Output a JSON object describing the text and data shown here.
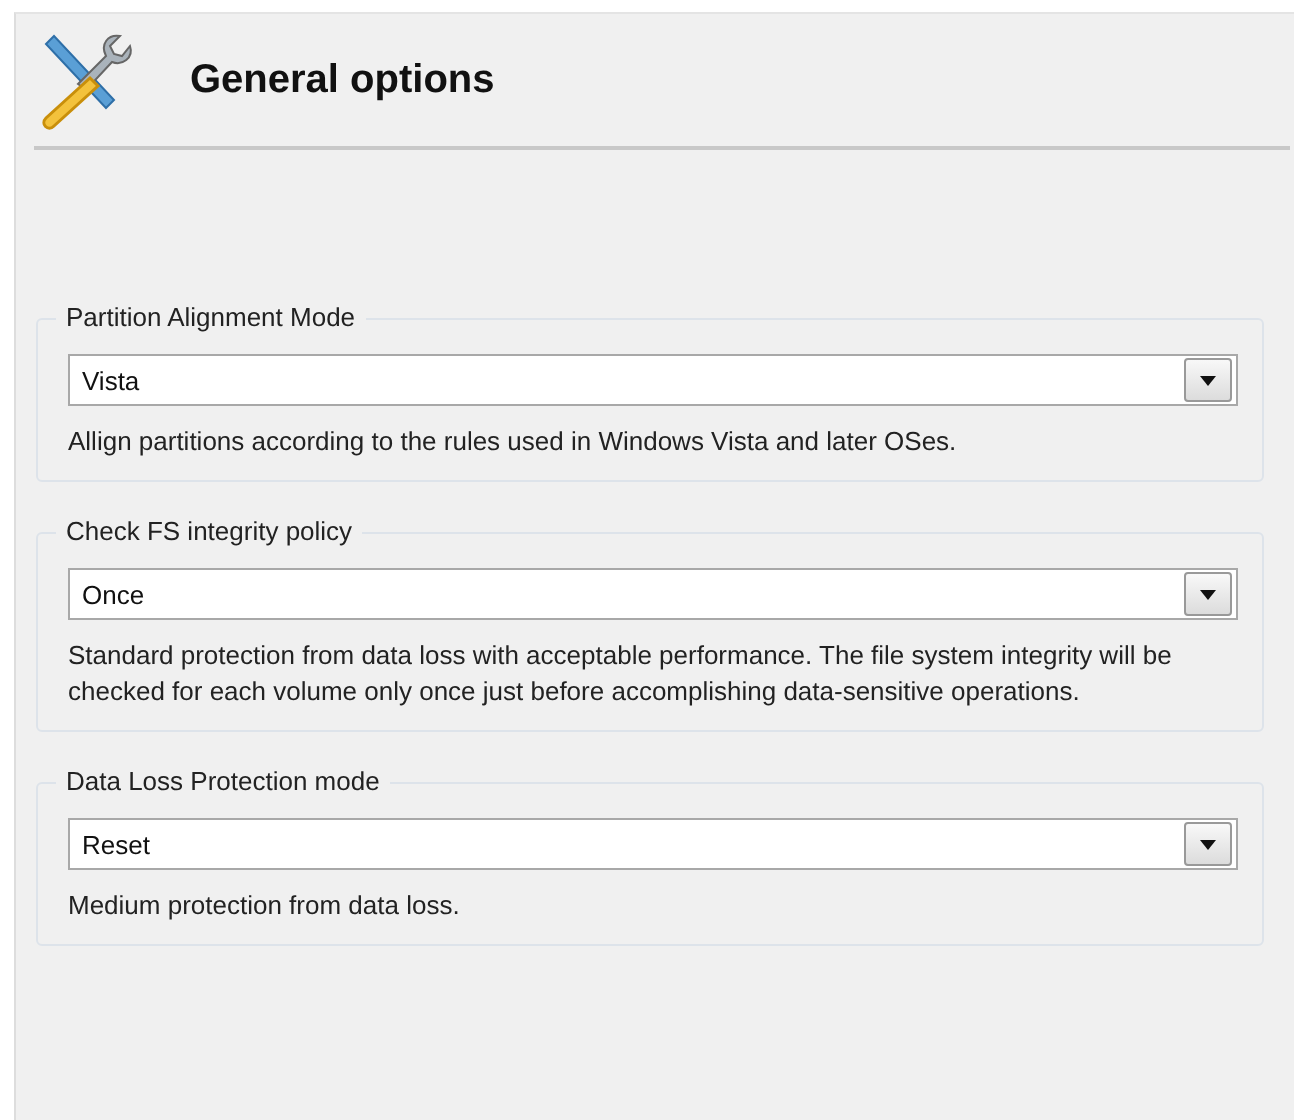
{
  "header": {
    "title": "General options"
  },
  "groups": [
    {
      "legend": "Partition Alignment Mode",
      "value": "Vista",
      "description": "Allign partitions according to the rules used in Windows Vista and later OSes."
    },
    {
      "legend": "Check FS integrity policy",
      "value": "Once",
      "description": "Standard protection from data loss with acceptable performance. The file system integrity will be checked for each volume only once just before accomplishing data-sensitive operations."
    },
    {
      "legend": "Data Loss Protection mode",
      "value": "Reset",
      "description": "Medium protection from data loss."
    }
  ]
}
